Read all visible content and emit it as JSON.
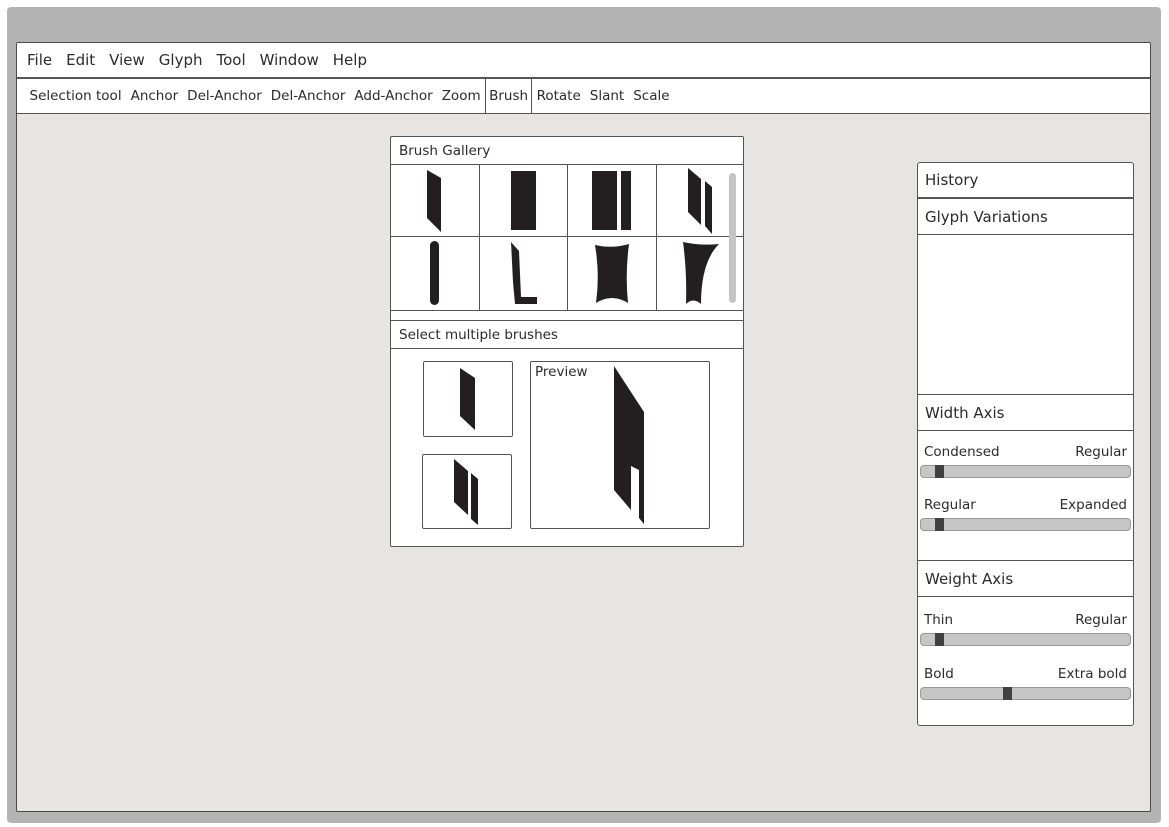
{
  "menubar": {
    "items": [
      "File",
      "Edit",
      "View",
      "Glyph",
      "Tool",
      "Window",
      "Help"
    ]
  },
  "toolbar": {
    "items": [
      "Selection tool",
      "Anchor",
      "Del-Anchor",
      "Del-Anchor",
      "Add-Anchor",
      "Zoom",
      "Brush",
      "Rotate",
      "Slant",
      "Scale"
    ],
    "active": "Brush"
  },
  "brush_gallery": {
    "title": "Brush Gallery",
    "brushes": [
      {
        "icon": "slanted-parallelogram-brush-icon"
      },
      {
        "icon": "rectangle-brush-icon"
      },
      {
        "icon": "double-rectangle-brush-icon"
      },
      {
        "icon": "double-slanted-brush-icon"
      },
      {
        "icon": "rounded-stroke-brush-icon"
      },
      {
        "icon": "l-shape-brush-icon"
      },
      {
        "icon": "concave-rectangle-brush-icon"
      },
      {
        "icon": "tapered-concave-brush-icon"
      }
    ],
    "multi_select_label": "Select multiple brushes",
    "selected": [
      {
        "icon": "slanted-parallelogram-brush-icon"
      },
      {
        "icon": "double-slanted-brush-icon"
      }
    ],
    "preview_label": "Preview"
  },
  "right_panel": {
    "history_label": "History",
    "glyph_variations_label": "Glyph Variations",
    "width_axis": {
      "title": "Width Axis",
      "sliders": [
        {
          "min_label": "Condensed",
          "max_label": "Regular",
          "value": 0.07
        },
        {
          "min_label": "Regular",
          "max_label": "Expanded",
          "value": 0.07
        }
      ]
    },
    "weight_axis": {
      "title": "Weight Axis",
      "sliders": [
        {
          "min_label": "Thin",
          "max_label": "Regular",
          "value": 0.07
        },
        {
          "min_label": "Bold",
          "max_label": "Extra bold",
          "value": 0.41
        }
      ]
    }
  }
}
